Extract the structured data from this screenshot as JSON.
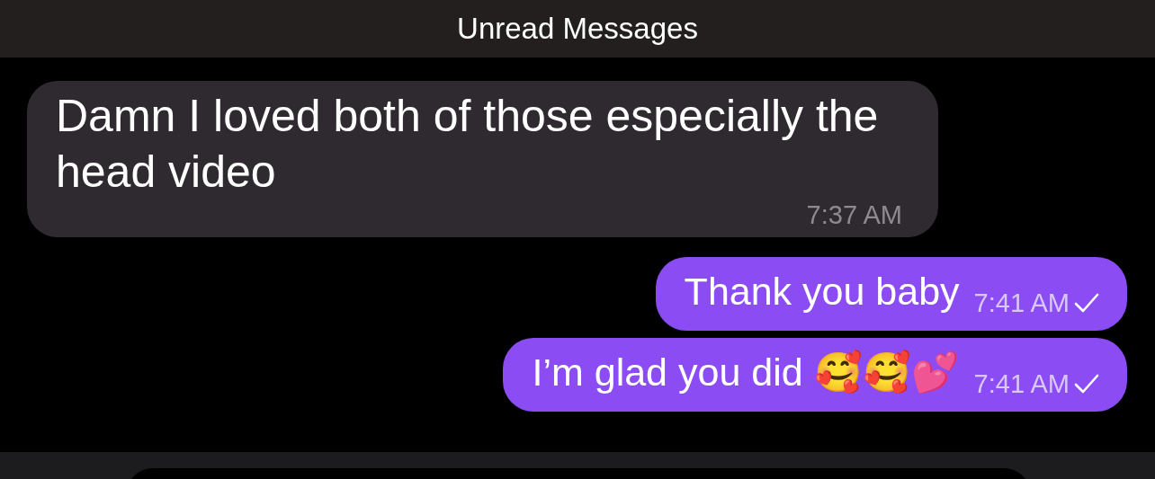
{
  "header": {
    "title": "Unread Messages"
  },
  "messages": [
    {
      "text": "Damn I loved both of those especially the head video",
      "time": "7:37 AM",
      "outgoing": false
    },
    {
      "text": "Thank you baby",
      "time": "7:41 AM",
      "outgoing": true,
      "delivered": true
    },
    {
      "text": "I’m glad you did 🥰🥰💕",
      "time": "7:41 AM",
      "outgoing": true,
      "delivered": true
    }
  ]
}
